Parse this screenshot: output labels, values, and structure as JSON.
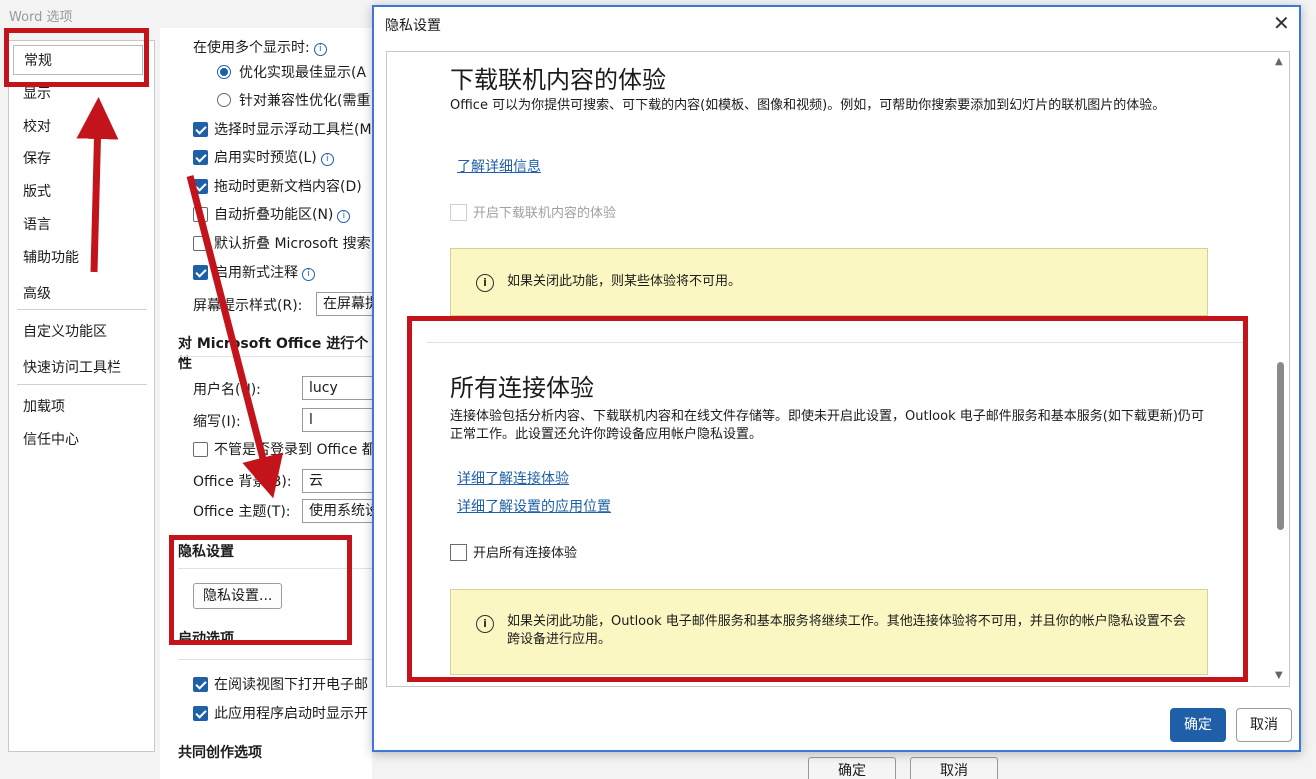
{
  "word_window": {
    "title": "Word 选项",
    "nav_items": [
      "常规",
      "显示",
      "校对",
      "保存",
      "版式",
      "语言",
      "辅助功能",
      "高级",
      "自定义功能区",
      "快速访问工具栏",
      "加载项",
      "信任中心"
    ],
    "selected_nav": "常规",
    "options": {
      "multi_display_label": "在使用多个显示时:",
      "radio_optimize": "优化实现最佳显示(A",
      "radio_compat": "针对兼容性优化(需重",
      "cb_floating_toolbar": "选择时显示浮动工具栏(M",
      "cb_live_preview": "启用实时预览(L)",
      "cb_update_drag": "拖动时更新文档内容(D)",
      "cb_collapse_ribbon": "自动折叠功能区(N)",
      "cb_collapse_search": "默认折叠 Microsoft 搜索",
      "cb_modern_comments": "启用新式注释",
      "screentip_label": "屏幕提示样式(R):",
      "screentip_value": "在屏幕提"
    },
    "personalize": {
      "heading": "对 Microsoft Office 进行个性",
      "username_label": "用户名(U):",
      "username_value": "lucy",
      "initials_label": "缩写(I):",
      "initials_value": "l",
      "cb_always_use": "不管是否登录到 Office 都",
      "background_label": "Office 背景(B):",
      "background_value": "云",
      "theme_label": "Office 主题(T):",
      "theme_value": "使用系统设"
    },
    "privacy_section": {
      "heading": "隐私设置",
      "button": "隐私设置..."
    },
    "startup": {
      "heading": "启动选项",
      "cb_reading_view": "在阅读视图下打开电子邮",
      "cb_start_screen": "此应用程序启动时显示开"
    },
    "coauthoring_heading": "共同创作选项",
    "ok": "确定",
    "cancel": "取消"
  },
  "privacy_dialog": {
    "title": "隐私设置",
    "download_section": {
      "heading": "下载联机内容的体验",
      "description": "Office 可以为你提供可搜索、可下载的内容(如模板、图像和视频)。例如，可帮助你搜索要添加到幻灯片的联机图片的体验。",
      "link": "了解详细信息",
      "checkbox": "开启下载联机内容的体验",
      "notice": "如果关闭此功能，则某些体验将不可用。"
    },
    "connected_section": {
      "heading": "所有连接体验",
      "description": "连接体验包括分析内容、下载联机内容和在线文件存储等。即使未开启此设置，Outlook 电子邮件服务和基本服务(如下载更新)仍可正常工作。此设置还允许你跨设备应用帐户隐私设置。",
      "link1": "详细了解连接体验",
      "link2": "详细了解设置的应用位置",
      "checkbox": "开启所有连接体验",
      "notice": "如果关闭此功能，Outlook 电子邮件服务和基本服务将继续工作。其他连接体验将不可用，并且你的帐户隐私设置不会跨设备进行应用。"
    },
    "ok": "确定",
    "cancel": "取消"
  },
  "colors": {
    "accent": "#1f5fa8",
    "annotation_red": "#c4141b",
    "notice_bg": "#fbf7c2"
  }
}
